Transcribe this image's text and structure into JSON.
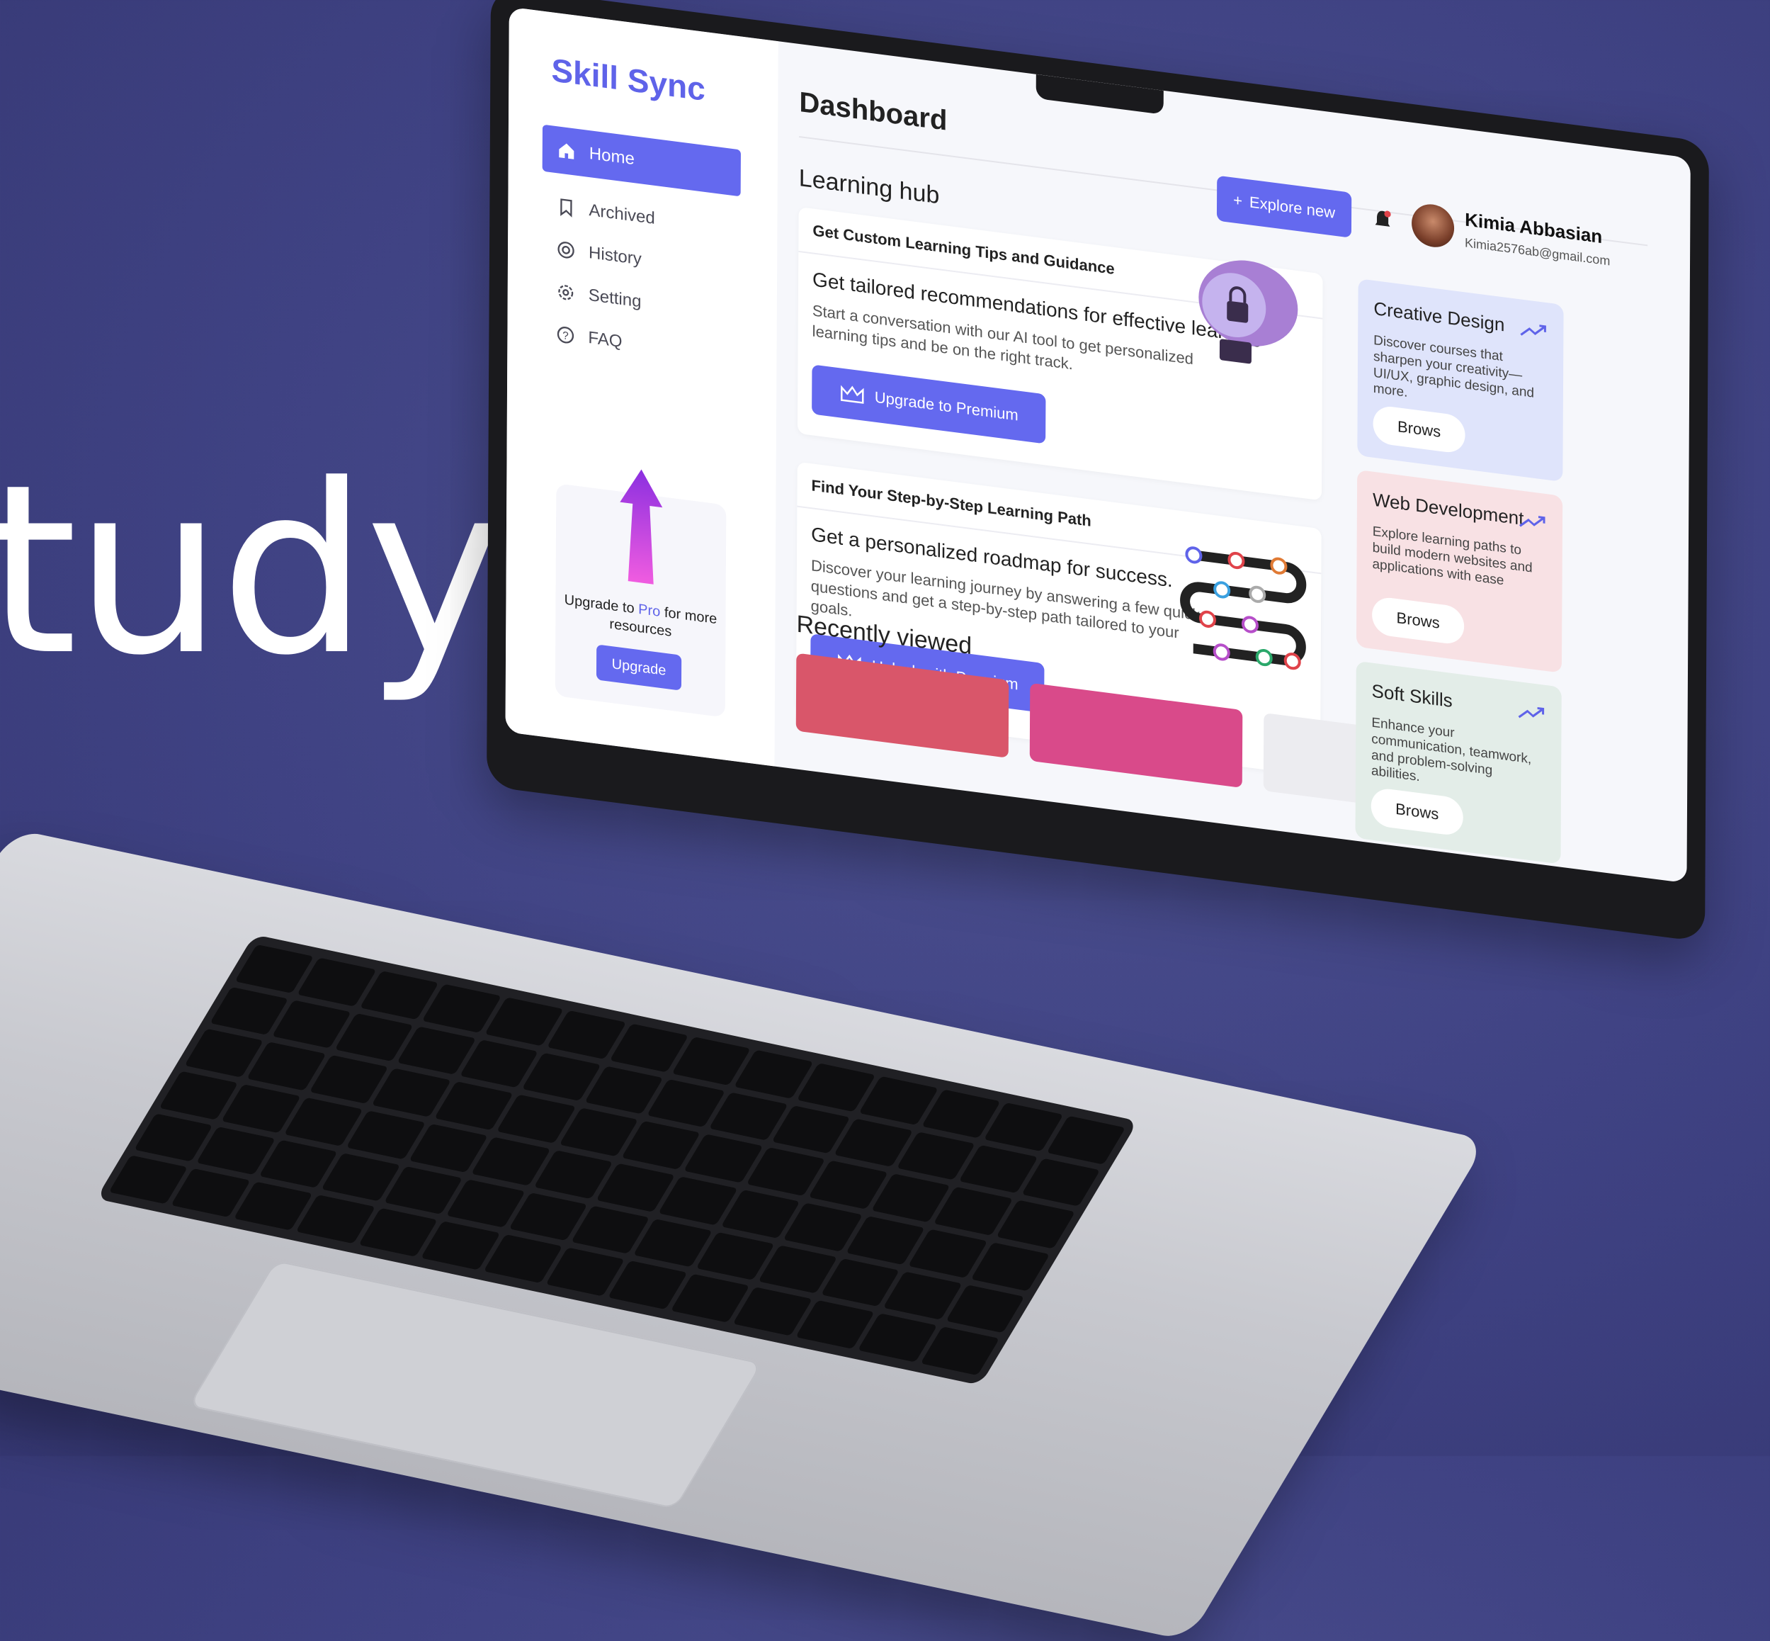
{
  "hero": {
    "text": "tudy"
  },
  "app": {
    "logo": "Skill Sync",
    "nav": [
      {
        "label": "Home",
        "icon": "home-icon",
        "active": true
      },
      {
        "label": "Archived",
        "icon": "bookmark-icon"
      },
      {
        "label": "History",
        "icon": "history-icon"
      },
      {
        "label": "Setting",
        "icon": "gear-icon"
      },
      {
        "label": "FAQ",
        "icon": "help-icon"
      }
    ],
    "upgrade_card": {
      "text_before": "Upgrade to ",
      "pro": "Pro",
      "text_after": " for more resources",
      "button": "Upgrade"
    }
  },
  "header": {
    "title": "Dashboard",
    "explore_button": "Explore new",
    "user": {
      "name": "Kimia Abbasian",
      "email": "Kimia2576ab@gmail.com"
    }
  },
  "hub": {
    "title": "Learning hub",
    "panels": [
      {
        "heading": "Get Custom Learning Tips and Guidance",
        "subtitle": "Get tailored recommendations for effective learning.",
        "description": "Start a conversation with our AI tool to get personalized learning tips and be on the right track.",
        "button": "Upgrade to Premium"
      },
      {
        "heading": "Find Your Step-by-Step Learning Path",
        "subtitle": "Get a personalized roadmap for success.",
        "description": "Discover your learning journey by answering a few quick questions and get a step-by-step path tailored to your goals.",
        "button": "Unlock with Premium"
      }
    ]
  },
  "categories": [
    {
      "title": "Creative Design",
      "description": "Discover courses that sharpen your creativity—UI/UX, graphic design, and more.",
      "button": "Brows",
      "color": "#dfe4fb"
    },
    {
      "title": "Web Development",
      "description": "Explore learning paths to build modern websites and applications with ease",
      "button": "Brows",
      "color": "#f8e1e4"
    },
    {
      "title": "Soft Skills",
      "description": "Enhance your communication, teamwork, and problem-solving abilities.",
      "button": "Brows",
      "color": "#e3ede8"
    }
  ],
  "recent": {
    "title": "Recently viewed"
  },
  "colors": {
    "accent": "#6469ef",
    "background": "#3f4283"
  }
}
